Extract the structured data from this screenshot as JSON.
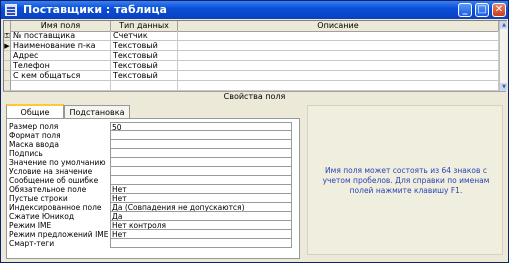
{
  "window": {
    "title": "Поставщики : таблица",
    "buttons": {
      "minimize": "_",
      "maximize": "□",
      "close": "✕"
    }
  },
  "grid": {
    "columns": [
      "Имя поля",
      "Тип данных",
      "Описание"
    ],
    "rows": [
      {
        "marker": "key-icon",
        "name": "№ поставщика",
        "type": "Счетчик",
        "description": ""
      },
      {
        "marker": "current-row-arrow-icon",
        "name": "Наименование п-ка",
        "type": "Текстовый",
        "description": ""
      },
      {
        "marker": "",
        "name": "Адрес",
        "type": "Текстовый",
        "description": ""
      },
      {
        "marker": "",
        "name": "Телефон",
        "type": "Текстовый",
        "description": ""
      },
      {
        "marker": "",
        "name": "С кем общаться",
        "type": "Текстовый",
        "description": ""
      }
    ]
  },
  "properties": {
    "title": "Свойства поля",
    "tabs": [
      "Общие",
      "Подстановка"
    ],
    "active_tab": "Общие",
    "rows": [
      {
        "label": "Размер поля",
        "value": "50"
      },
      {
        "label": "Формат поля",
        "value": ""
      },
      {
        "label": "Маска ввода",
        "value": ""
      },
      {
        "label": "Подпись",
        "value": ""
      },
      {
        "label": "Значение по умолчанию",
        "value": ""
      },
      {
        "label": "Условие на значение",
        "value": ""
      },
      {
        "label": "Сообщение об ошибке",
        "value": ""
      },
      {
        "label": "Обязательное поле",
        "value": "Нет"
      },
      {
        "label": "Пустые строки",
        "value": "Нет"
      },
      {
        "label": "Индексированное поле",
        "value": "Да (Совпадения не допускаются)"
      },
      {
        "label": "Сжатие Юникод",
        "value": "Да"
      },
      {
        "label": "Режим IME",
        "value": "Нет контроля"
      },
      {
        "label": "Режим предложений IME",
        "value": "Нет"
      },
      {
        "label": "Смарт-теги",
        "value": ""
      }
    ],
    "help_text": "Имя поля может состоять из 64 знаков с учетом пробелов.  Для справки по именам полей нажмите клавишу F1."
  }
}
